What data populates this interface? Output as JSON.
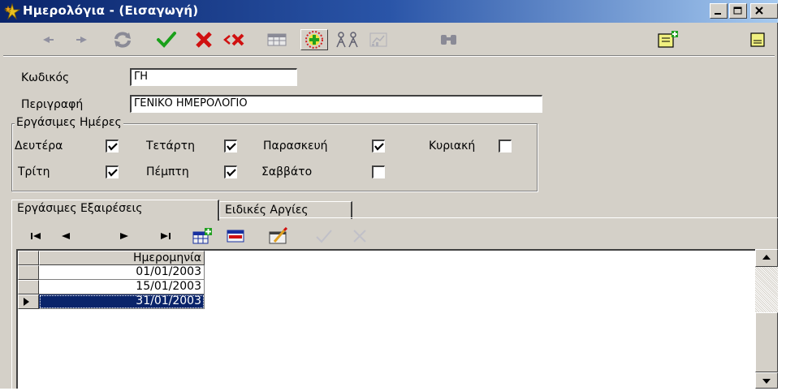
{
  "window": {
    "title": "Ημερολόγια - (Εισαγωγή)"
  },
  "toolbar": {
    "buttons": [
      "prev-icon",
      "next-icon",
      "refresh-icon",
      "check-icon",
      "cancel-icon",
      "undo-cancel-icon",
      "table-icon",
      "add-icon",
      "people-icon",
      "chart-icon",
      "binoculars-icon",
      "new-doc-icon",
      "doc-icon"
    ]
  },
  "form": {
    "code_label": "Κωδικός",
    "code_value": "ΓΗ",
    "desc_label": "Περιγραφή",
    "desc_value": "ΓΕΝΙΚΟ ΗΜΕΡΟΛΟΓΙΟ"
  },
  "workdays": {
    "group_title": "Εργάσιμες Ημέρες",
    "days": [
      {
        "label": "Δευτέρα",
        "checked": true
      },
      {
        "label": "Τετάρτη",
        "checked": true
      },
      {
        "label": "Παρασκευή",
        "checked": true
      },
      {
        "label": "Κυριακή",
        "checked": false
      },
      {
        "label": "Τρίτη",
        "checked": true
      },
      {
        "label": "Πέμπτη",
        "checked": true
      },
      {
        "label": "Σαββάτο",
        "checked": false
      }
    ]
  },
  "tabs": [
    {
      "label": "Εργάσιμες Εξαιρέσεις",
      "active": true
    },
    {
      "label": "Ειδικές Αργίες",
      "active": false
    }
  ],
  "grid": {
    "column_header": "Ημερομηνία",
    "rows": [
      "01/01/2003",
      "15/01/2003",
      "31/01/2003"
    ],
    "selected_row": 2
  },
  "colors": {
    "title_start": "#0a246a",
    "title_end": "#a6caf0",
    "selection": "#0a246a",
    "face": "#d4d0c8"
  }
}
